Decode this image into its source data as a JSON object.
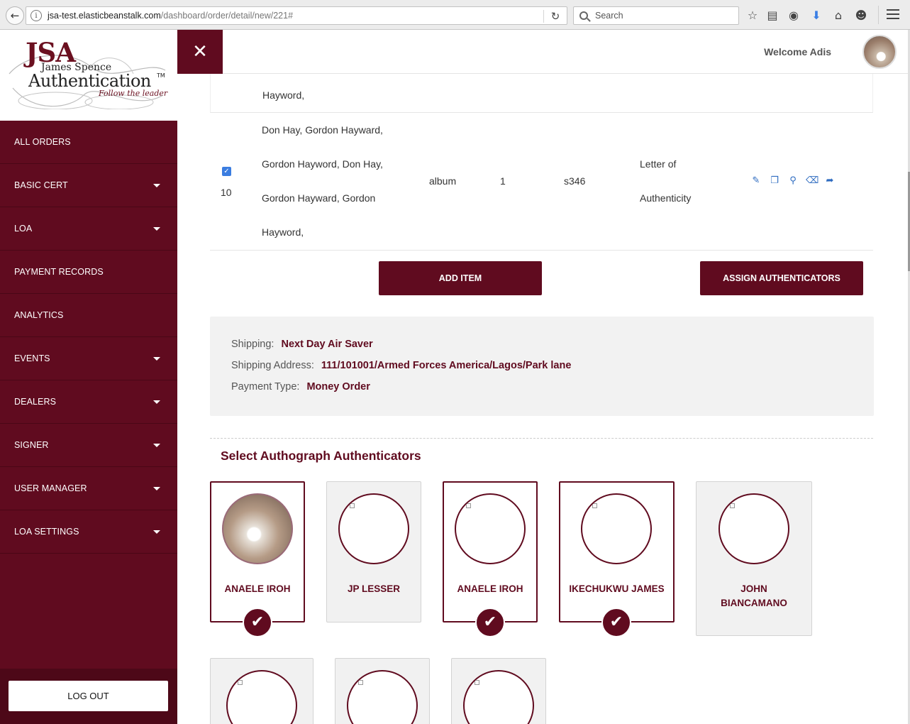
{
  "browser": {
    "url_host": "jsa-test.elasticbeanstalk.com",
    "url_path": "/dashboard/order/detail/new/221#",
    "search_placeholder": "Search"
  },
  "sidebar": {
    "logo": {
      "jsa": "JSA",
      "name": "James Spence",
      "auth": "Authentication",
      "tm": "TM",
      "tagline": "Follow the leader"
    },
    "items": [
      {
        "label": "ALL ORDERS",
        "has_caret": false
      },
      {
        "label": "BASIC CERT",
        "has_caret": true
      },
      {
        "label": "LOA",
        "has_caret": true
      },
      {
        "label": "PAYMENT RECORDS",
        "has_caret": false
      },
      {
        "label": "ANALYTICS",
        "has_caret": false
      },
      {
        "label": "EVENTS",
        "has_caret": true
      },
      {
        "label": "DEALERS",
        "has_caret": true
      },
      {
        "label": "SIGNER",
        "has_caret": true
      },
      {
        "label": "USER MANAGER",
        "has_caret": true
      },
      {
        "label": "LOA SETTINGS",
        "has_caret": true
      }
    ],
    "logout_label": "LOG OUT"
  },
  "header": {
    "close_glyph": "✕",
    "welcome": "Welcome Adis"
  },
  "table": {
    "prev_row_tail": "Hayword,",
    "row": {
      "checked": true,
      "number": "10",
      "signer_lines": [
        "Don Hay, Gordon Hayward,",
        "Gordon Hayword, Don Hay,",
        "Gordon Hayward, Gordon",
        "Hayword,"
      ],
      "item_type": "album",
      "quantity": "1",
      "code": "s346",
      "cert_line1": "Letter of",
      "cert_line2": "Authenticity",
      "actions": [
        "edit-icon",
        "copy-icon",
        "zoom-icon",
        "trash-icon",
        "share-icon"
      ]
    }
  },
  "buttons": {
    "add_item": "ADD ITEM",
    "assign": "ASSIGN AUTHENTICATORS"
  },
  "shipping": {
    "shipping_label": "Shipping:",
    "shipping_value": "Next Day Air Saver",
    "address_label": "Shipping Address:",
    "address_value": "111/101001/Armed Forces America/Lagos/Park lane",
    "payment_label": "Payment Type:",
    "payment_value": "Money Order"
  },
  "authenticators": {
    "title": "Select Authograph Authenticators",
    "cards": [
      {
        "name": "ANAELE IROH",
        "selected": true,
        "photo": true
      },
      {
        "name": "JP LESSER",
        "selected": false,
        "photo": false
      },
      {
        "name": "ANAELE IROH",
        "selected": true,
        "photo": false
      },
      {
        "name": "IKECHUKWU JAMES",
        "selected": true,
        "photo": false
      },
      {
        "name": "JOHN BIANCAMANO",
        "selected": false,
        "photo": false
      },
      {
        "name": "",
        "selected": false,
        "photo": false
      },
      {
        "name": "",
        "selected": false,
        "photo": false
      },
      {
        "name": "",
        "selected": false,
        "photo": false
      }
    ]
  },
  "colors": {
    "brand": "#600b1f",
    "sidebar_footer": "#4d0818",
    "panel_bg": "#f2f2f2",
    "link_blue": "#2d6bc0"
  }
}
